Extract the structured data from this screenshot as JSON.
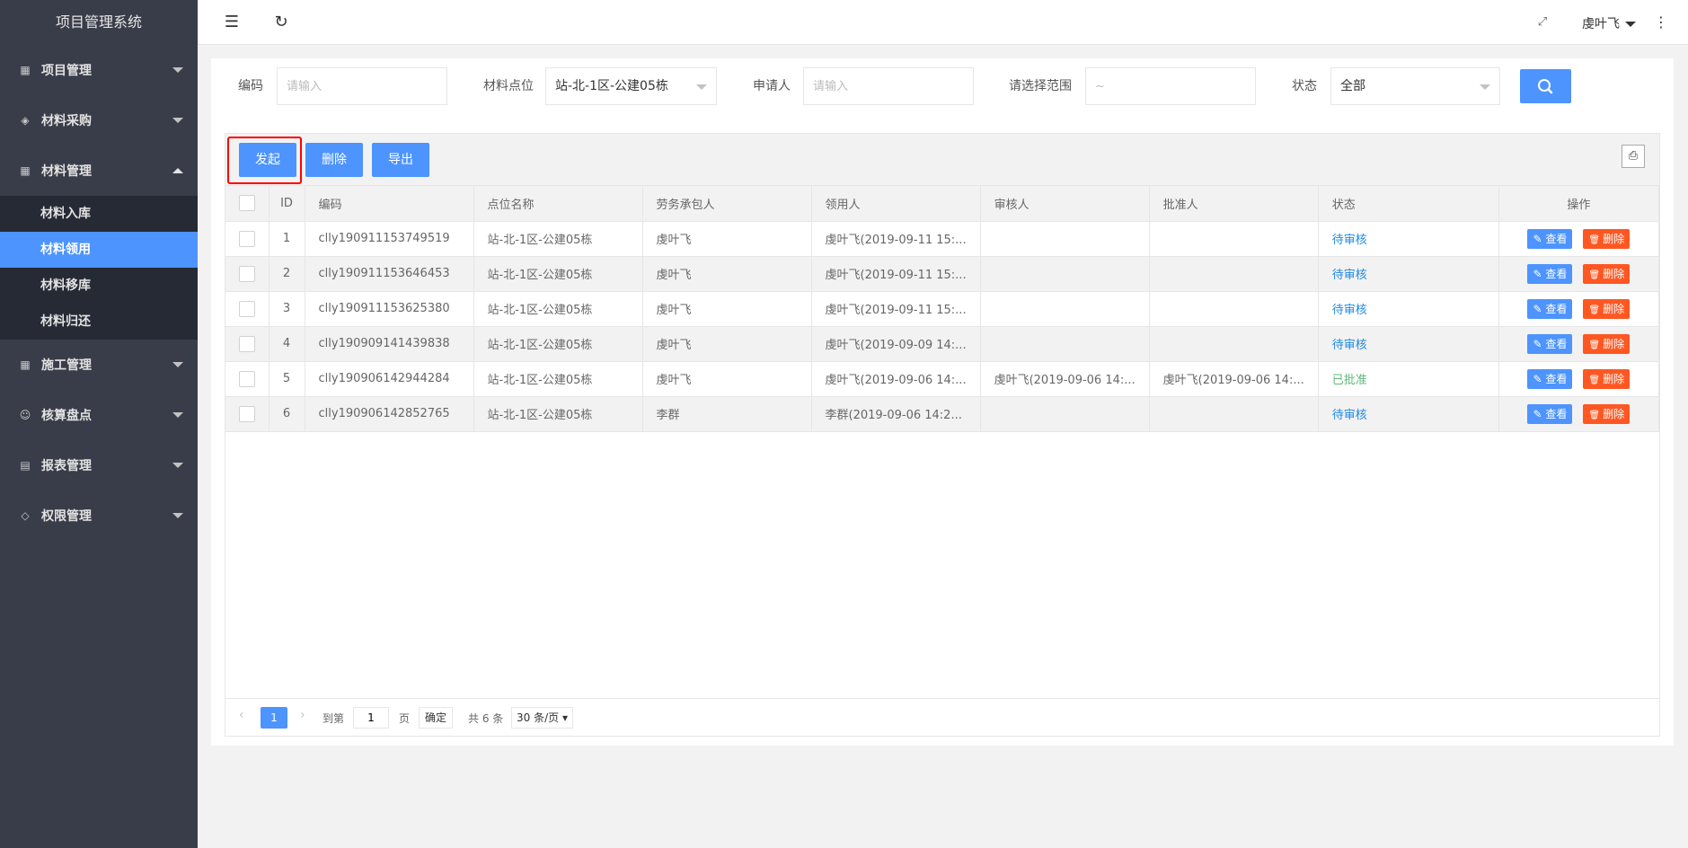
{
  "app": {
    "title": "项目管理系统"
  },
  "sidebar": {
    "items": [
      {
        "label": "项目管理",
        "icon": "grid-icon"
      },
      {
        "label": "材料采购",
        "icon": "layers-icon"
      },
      {
        "label": "材料管理",
        "icon": "grid-icon",
        "expanded": true,
        "children": [
          {
            "label": "材料入库"
          },
          {
            "label": "材料领用",
            "active": true
          },
          {
            "label": "材料移库"
          },
          {
            "label": "材料归还"
          }
        ]
      },
      {
        "label": "施工管理",
        "icon": "grid-icon"
      },
      {
        "label": "核算盘点",
        "icon": "user-icon"
      },
      {
        "label": "报表管理",
        "icon": "clipboard-icon"
      },
      {
        "label": "权限管理",
        "icon": "shield-icon"
      }
    ]
  },
  "header": {
    "user": "虔叶飞"
  },
  "filters": {
    "code_label": "编码",
    "code_placeholder": "请输入",
    "location_label": "材料点位",
    "location_value": "站-北-1区-公建05栋",
    "applicant_label": "申请人",
    "applicant_placeholder": "请输入",
    "range_label": "请选择范围",
    "range_placeholder": "~",
    "status_label": "状态",
    "status_value": "全部"
  },
  "toolbar": {
    "start": "发起",
    "delete": "删除",
    "export": "导出"
  },
  "table": {
    "columns": [
      "ID",
      "编码",
      "点位名称",
      "劳务承包人",
      "领用人",
      "审核人",
      "批准人",
      "状态",
      "操作"
    ],
    "rows": [
      {
        "id": "1",
        "code": "clly190911153749519",
        "location": "站-北-1区-公建05栋",
        "contractor": "虔叶飞",
        "recipient": "虔叶飞(2019-09-11 15:...",
        "reviewer": "",
        "approver": "",
        "status": "待审核",
        "status_type": "pending"
      },
      {
        "id": "2",
        "code": "clly190911153646453",
        "location": "站-北-1区-公建05栋",
        "contractor": "虔叶飞",
        "recipient": "虔叶飞(2019-09-11 15:...",
        "reviewer": "",
        "approver": "",
        "status": "待审核",
        "status_type": "pending"
      },
      {
        "id": "3",
        "code": "clly190911153625380",
        "location": "站-北-1区-公建05栋",
        "contractor": "虔叶飞",
        "recipient": "虔叶飞(2019-09-11 15:...",
        "reviewer": "",
        "approver": "",
        "status": "待审核",
        "status_type": "pending"
      },
      {
        "id": "4",
        "code": "clly190909141439838",
        "location": "站-北-1区-公建05栋",
        "contractor": "虔叶飞",
        "recipient": "虔叶飞(2019-09-09 14:...",
        "reviewer": "",
        "approver": "",
        "status": "待审核",
        "status_type": "pending"
      },
      {
        "id": "5",
        "code": "clly190906142944284",
        "location": "站-北-1区-公建05栋",
        "contractor": "虔叶飞",
        "recipient": "虔叶飞(2019-09-06 14:...",
        "reviewer": "虔叶飞(2019-09-06 14:...",
        "approver": "虔叶飞(2019-09-06 14:...",
        "status": "已批准",
        "status_type": "approved"
      },
      {
        "id": "6",
        "code": "clly190906142852765",
        "location": "站-北-1区-公建05栋",
        "contractor": "李群",
        "recipient": "李群(2019-09-06 14:2...",
        "reviewer": "",
        "approver": "",
        "status": "待审核",
        "status_type": "pending"
      }
    ],
    "action_view": "查看",
    "action_delete": "删除"
  },
  "pager": {
    "current": "1",
    "goto_label": "到第",
    "goto_value": "1",
    "page_unit": "页",
    "confirm": "确定",
    "total": "共 6 条",
    "page_size": "30 条/页"
  },
  "colors": {
    "primary": "#4d94fe",
    "danger": "#ff5722",
    "sidebar_bg": "#393d49",
    "submenu_bg": "#262a35",
    "approved": "#5fb878"
  }
}
